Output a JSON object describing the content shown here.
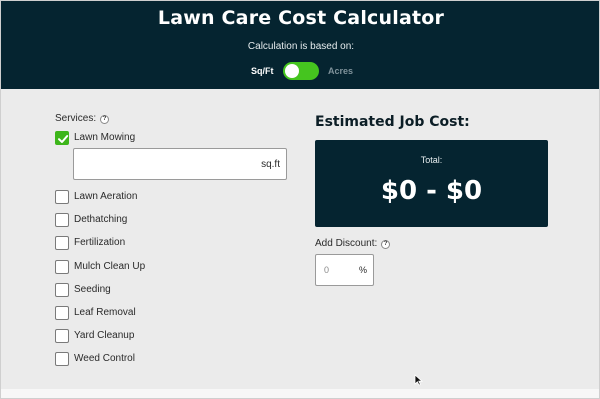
{
  "header": {
    "title": "Lawn Care Cost Calculator",
    "subtitle": "Calculation is based on:",
    "unit_left": "Sq/Ft",
    "unit_right": "Acres",
    "toggle_state": "Sq/Ft"
  },
  "services": {
    "label": "Services:",
    "help_icon": "?",
    "sqft_unit": "sq.ft",
    "items": [
      {
        "label": "Lawn Mowing",
        "checked": true
      },
      {
        "label": "Lawn Aeration",
        "checked": false
      },
      {
        "label": "Dethatching",
        "checked": false
      },
      {
        "label": "Fertilization",
        "checked": false
      },
      {
        "label": "Mulch Clean Up",
        "checked": false
      },
      {
        "label": "Seeding",
        "checked": false
      },
      {
        "label": "Leaf Removal",
        "checked": false
      },
      {
        "label": "Yard Cleanup",
        "checked": false
      },
      {
        "label": "Weed Control",
        "checked": false
      }
    ]
  },
  "estimate": {
    "title": "Estimated Job Cost:",
    "total_label": "Total:",
    "total_value": "$0 - $0"
  },
  "discount": {
    "label": "Add Discount:",
    "help_icon": "?",
    "value": "0",
    "unit": "%"
  },
  "colors": {
    "header_bg": "#052430",
    "accent_green": "#45c51f",
    "page_bg": "#ebebeb"
  }
}
